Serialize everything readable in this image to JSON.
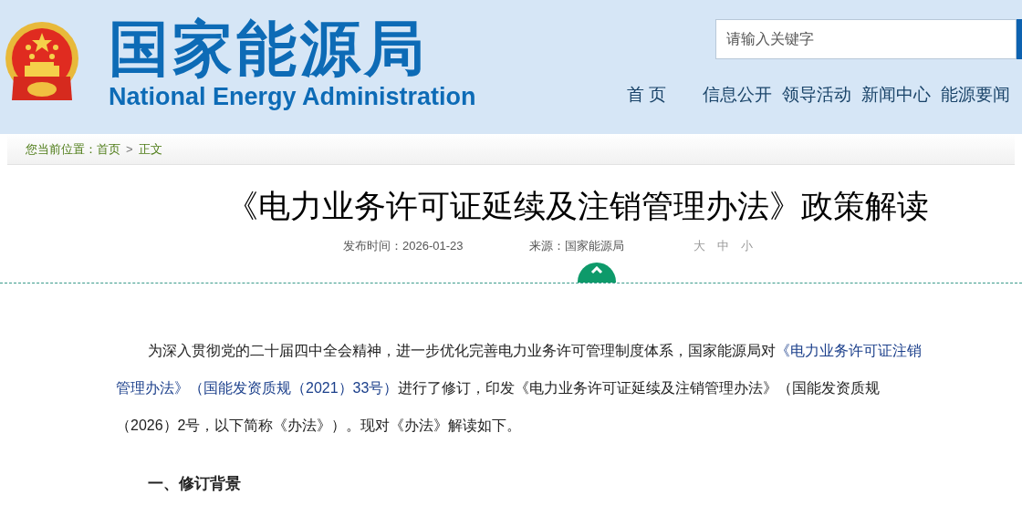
{
  "header": {
    "title": "国家能源局",
    "subtitle": "National Energy Administration",
    "search": {
      "placeholder": "请输入关键字"
    },
    "nav": [
      {
        "label": "首 页"
      },
      {
        "label": "信息公开"
      },
      {
        "label": "领导活动"
      },
      {
        "label": "新闻中心"
      },
      {
        "label": "能源要闻"
      }
    ]
  },
  "breadcrumb": {
    "prefix": "您当前位置：",
    "items": [
      {
        "label": "首页"
      },
      {
        "label": "正文"
      }
    ],
    "separator": ">"
  },
  "article": {
    "title": "《电力业务许可证延续及注销管理办法》政策解读",
    "date": "发布时间：2026-01-23",
    "source": "来源：国家能源局",
    "font_sizes": [
      {
        "label": "大"
      },
      {
        "label": "中"
      },
      {
        "label": "小"
      }
    ],
    "paragraph_lines": [
      [
        {
          "kind": "text",
          "text": "为深入贯彻党的二十届四中全会精神，进一步优化完善电力业务许可管理制度体系，国家能源局对"
        },
        {
          "kind": "link",
          "text": "《电力业务许可证注销"
        }
      ],
      [
        {
          "kind": "link",
          "text": "管理办法》（国能发资质规（2021）33号）"
        },
        {
          "kind": "text",
          "text": "进行了修订，印发《电力业务许可证延续及注销管理办法》（国能发资质规"
        }
      ],
      [
        {
          "kind": "text",
          "text": "（2026）2号，以下简称《办法》）。现对《办法》解读如下。"
        }
      ]
    ],
    "heading": "一、修订背景"
  }
}
